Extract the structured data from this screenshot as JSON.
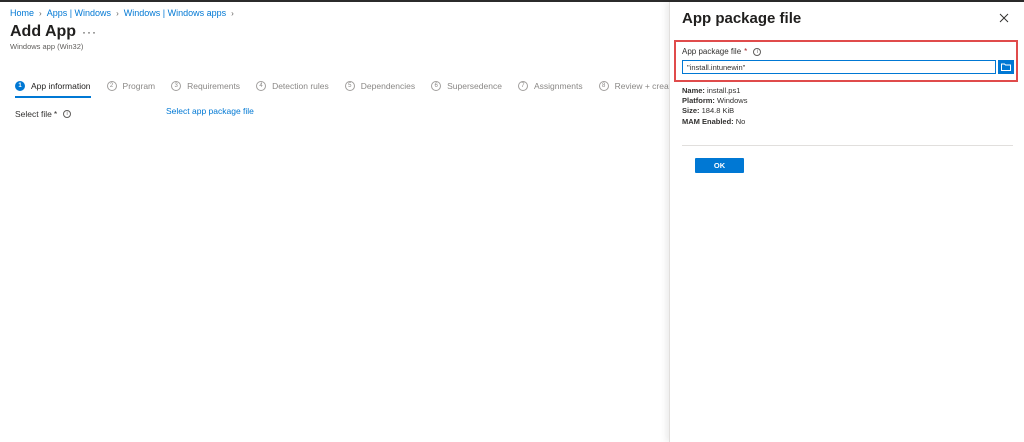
{
  "breadcrumb": [
    {
      "label": "Home"
    },
    {
      "label": "Apps | Windows"
    },
    {
      "label": "Windows | Windows apps"
    }
  ],
  "page": {
    "title": "Add App",
    "more": "···",
    "subtitle": "Windows app (Win32)"
  },
  "steps": [
    {
      "num": "1",
      "label": "App information",
      "active": true
    },
    {
      "num": "2",
      "label": "Program"
    },
    {
      "num": "3",
      "label": "Requirements"
    },
    {
      "num": "4",
      "label": "Detection rules"
    },
    {
      "num": "5",
      "label": "Dependencies"
    },
    {
      "num": "6",
      "label": "Supersedence"
    },
    {
      "num": "7",
      "label": "Assignments"
    },
    {
      "num": "8",
      "label": "Review + create"
    }
  ],
  "main": {
    "select_file_label": "Select file",
    "required_mark": "*",
    "select_link": "Select app package file"
  },
  "panel": {
    "title": "App package file",
    "field_label": "App package file",
    "required_mark": "*",
    "input_value": "\"install.intunewin\"",
    "info": {
      "name_label": "Name:",
      "name_value": "install.ps1",
      "platform_label": "Platform:",
      "platform_value": "Windows",
      "size_label": "Size:",
      "size_value": "184.8 KiB",
      "mam_label": "MAM Enabled:",
      "mam_value": "No"
    },
    "ok_label": "OK"
  },
  "icons": {
    "close": "close-icon",
    "browse": "folder-icon",
    "info": "info-icon"
  },
  "colors": {
    "accent": "#0078d4",
    "highlight": "#e04b4b",
    "required": "#a4262c"
  }
}
